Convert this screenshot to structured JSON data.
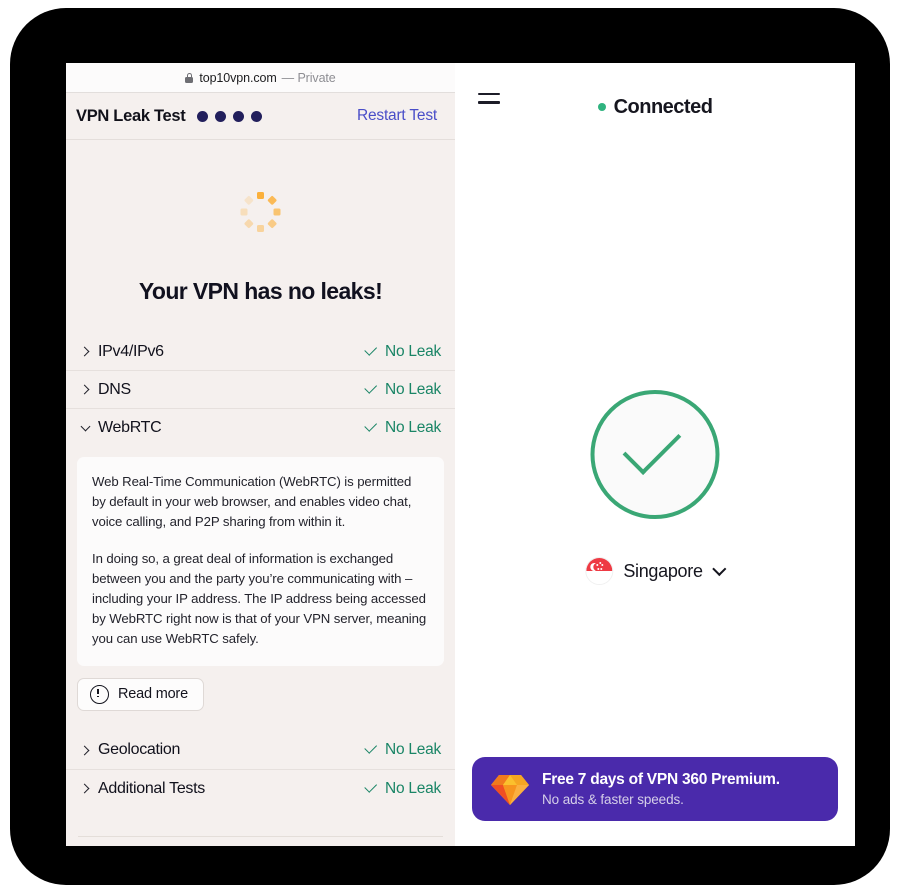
{
  "browser": {
    "url": "top10vpn.com",
    "privacy_mode": "— Private",
    "lock_icon": "lock-icon"
  },
  "leak_test": {
    "title": "VPN Leak Test",
    "progress_dots": 4,
    "restart_label": "Restart Test",
    "heading": "Your VPN has no leaks!",
    "spinner_icon": "loading-spinner-icon",
    "rows": [
      {
        "label": "IPv4/IPv6",
        "status": "No Leak",
        "expanded": false
      },
      {
        "label": "DNS",
        "status": "No Leak",
        "expanded": false
      },
      {
        "label": "WebRTC",
        "status": "No Leak",
        "expanded": true
      }
    ],
    "lower_rows": [
      {
        "label": "Geolocation",
        "status": "No Leak",
        "expanded": false
      },
      {
        "label": "Additional Tests",
        "status": "No Leak",
        "expanded": false
      }
    ],
    "webrtc_detail": {
      "paragraph1": "Web Real-Time Communication (WebRTC) is permitted by default in your web browser, and enables video chat, voice calling, and P2P sharing from within it.",
      "paragraph2": "In doing so, a great deal of information is exchanged between you and the party you’re communicating with – including your IP address. The IP address being accessed by WebRTC right now is that of your VPN server, meaning you can use WebRTC safely."
    },
    "read_more_label": "Read more",
    "read_more_icon": "exclamation-circle-icon"
  },
  "vpn_app": {
    "menu_icon": "hamburger-menu-icon",
    "status": "Connected",
    "status_dot_color": "#2fb37f",
    "connect_button_icon": "check-circle-icon",
    "location": "Singapore",
    "location_flag_icon": "singapore-flag-icon",
    "location_chevron_icon": "chevron-down-icon",
    "promo": {
      "icon": "gem-icon",
      "title": "Free 7 days of VPN 360 Premium.",
      "subtitle": "No ads & faster speeds.",
      "background": "#4a2aab"
    }
  },
  "colors": {
    "leak_green": "#1a8566",
    "restart_blue": "#4a4ec8",
    "spinner_orange": "#fbb03b",
    "progress_dot": "#221f5c",
    "panel_bg": "#f5f0ee"
  }
}
